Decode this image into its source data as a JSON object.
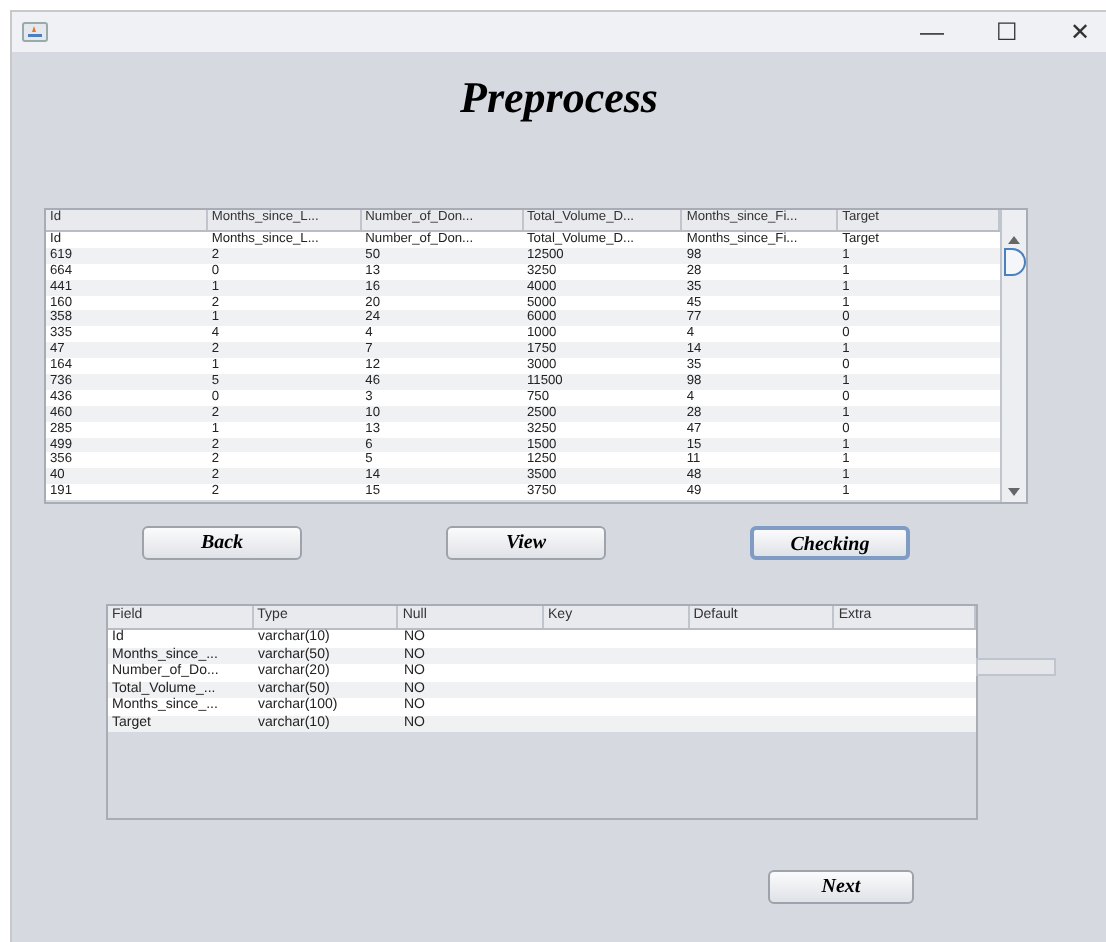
{
  "window": {
    "title_bar_buttons": [
      "—",
      "☐",
      "✕"
    ]
  },
  "title": "Preprocess",
  "data_table": {
    "columns": [
      "Id",
      "Months_since_L...",
      "Number_of_Don...",
      "Total_Volume_D...",
      "Months_since_Fi...",
      "Target"
    ],
    "rows": [
      [
        "Id",
        "Months_since_L...",
        "Number_of_Don...",
        "Total_Volume_D...",
        "Months_since_Fi...",
        "Target"
      ],
      [
        "619",
        "2",
        "50",
        "12500",
        "98",
        "1"
      ],
      [
        "664",
        "0",
        "13",
        "3250",
        "28",
        "1"
      ],
      [
        "441",
        "1",
        "16",
        "4000",
        "35",
        "1"
      ],
      [
        "160",
        "2",
        "20",
        "5000",
        "45",
        "1"
      ],
      [
        "358",
        "1",
        "24",
        "6000",
        "77",
        "0"
      ],
      [
        "335",
        "4",
        "4",
        "1000",
        "4",
        "0"
      ],
      [
        "47",
        "2",
        "7",
        "1750",
        "14",
        "1"
      ],
      [
        "164",
        "1",
        "12",
        "3000",
        "35",
        "0"
      ],
      [
        "736",
        "5",
        "46",
        "11500",
        "98",
        "1"
      ],
      [
        "436",
        "0",
        "3",
        "750",
        "4",
        "0"
      ],
      [
        "460",
        "2",
        "10",
        "2500",
        "28",
        "1"
      ],
      [
        "285",
        "1",
        "13",
        "3250",
        "47",
        "0"
      ],
      [
        "499",
        "2",
        "6",
        "1500",
        "15",
        "1"
      ],
      [
        "356",
        "2",
        "5",
        "1250",
        "11",
        "1"
      ],
      [
        "40",
        "2",
        "14",
        "3500",
        "48",
        "1"
      ],
      [
        "191",
        "2",
        "15",
        "3750",
        "49",
        "1"
      ]
    ]
  },
  "buttons": [
    {
      "label": "Back",
      "focused": false
    },
    {
      "label": "View",
      "focused": false
    },
    {
      "label": "Checking",
      "focused": true
    }
  ],
  "schema_table": {
    "columns": [
      "Field",
      "Type",
      "Null",
      "Key",
      "Default",
      "Extra"
    ],
    "rows": [
      [
        "Id",
        "varchar(10)",
        "NO"
      ],
      [
        "Months_since_...",
        "varchar(50)",
        "NO"
      ],
      [
        "Number_of_Do...",
        "varchar(20)",
        "NO"
      ],
      [
        "Total_Volume_...",
        "varchar(50)",
        "NO"
      ],
      [
        "Months_since_...",
        "varchar(100)",
        "NO"
      ],
      [
        "Target",
        "varchar(10)",
        "NO"
      ]
    ]
  },
  "next_button": {
    "label": "Next"
  }
}
